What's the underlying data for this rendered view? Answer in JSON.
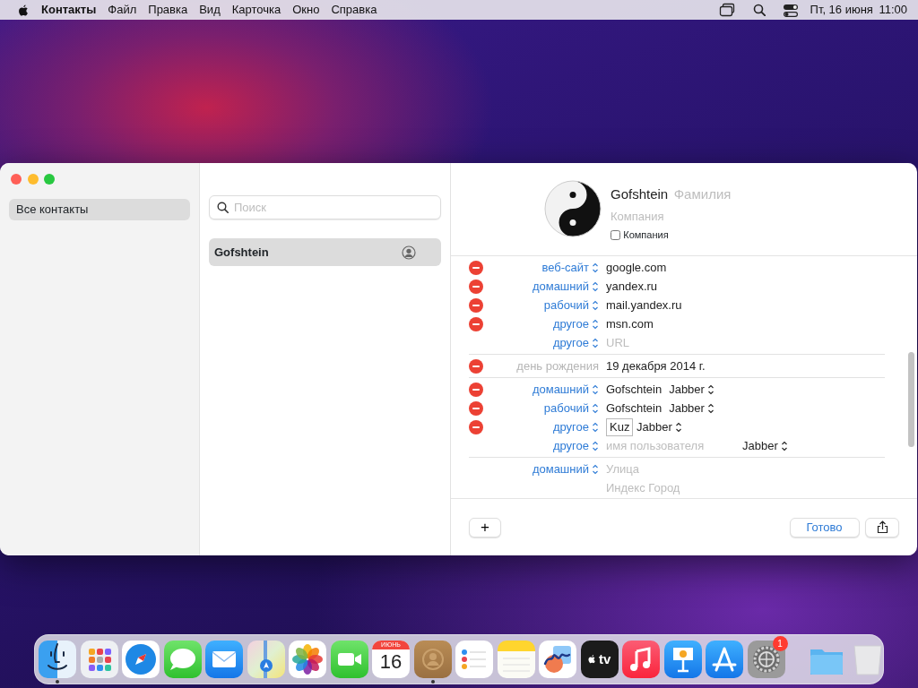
{
  "menubar": {
    "app": "Контакты",
    "menus": [
      "Файл",
      "Правка",
      "Вид",
      "Карточка",
      "Окно",
      "Справка"
    ],
    "date": "Пт, 16 июня",
    "time": "11:00"
  },
  "sidebar": {
    "items": [
      {
        "label": "Все контакты",
        "selected": true
      }
    ]
  },
  "search": {
    "placeholder": "Поиск"
  },
  "contacts": [
    {
      "name": "Gofshtein",
      "selected": true
    }
  ],
  "card": {
    "first_name": "Gofshtein",
    "last_name_placeholder": "Фамилия",
    "company_placeholder": "Компания",
    "company_checkbox": {
      "label": "Компания",
      "checked": false
    },
    "groups": [
      {
        "rows": [
          {
            "label": "веб-сайт",
            "popup": true,
            "removable": true,
            "value": "google.com"
          },
          {
            "label": "домашний",
            "popup": true,
            "removable": true,
            "value": "yandex.ru"
          },
          {
            "label": "рабочий",
            "popup": true,
            "removable": true,
            "value": "mail.yandex.ru"
          },
          {
            "label": "другое",
            "popup": true,
            "removable": true,
            "value": "msn.com"
          },
          {
            "label": "другое",
            "popup": true,
            "removable": false,
            "placeholder": "URL"
          }
        ]
      },
      {
        "rows": [
          {
            "label": "день рождения",
            "popup": false,
            "removable": true,
            "value": "19 декабря 2014 г."
          }
        ]
      },
      {
        "rows": [
          {
            "label": "домашний",
            "popup": true,
            "removable": true,
            "value": "Gofschtein",
            "service": "Jabber"
          },
          {
            "label": "рабочий",
            "popup": true,
            "removable": true,
            "value": "Gofschtein",
            "service": "Jabber"
          },
          {
            "label": "другое",
            "popup": true,
            "removable": true,
            "value": "Kuz",
            "editing": true,
            "service": "Jabber"
          },
          {
            "label": "другое",
            "popup": true,
            "removable": false,
            "placeholder": "имя пользователя",
            "service": "Jabber"
          }
        ]
      },
      {
        "rows": [
          {
            "label": "домашний",
            "popup": true,
            "removable": false,
            "placeholder": "Улица"
          },
          {
            "removable": false,
            "placeholder": "Индекс Город"
          }
        ]
      }
    ]
  },
  "footer": {
    "add": "+",
    "done": "Готово"
  },
  "dock": [
    {
      "kind": "finder",
      "running": true
    },
    {
      "kind": "launchpad",
      "running": false
    },
    {
      "kind": "safari",
      "running": false
    },
    {
      "kind": "messages",
      "running": false
    },
    {
      "kind": "mail",
      "running": false
    },
    {
      "kind": "maps",
      "running": false
    },
    {
      "kind": "photos",
      "running": false
    },
    {
      "kind": "facetime",
      "running": false
    },
    {
      "kind": "calendar",
      "running": false,
      "month": "ИЮНЬ",
      "day": "16"
    },
    {
      "kind": "contacts",
      "running": true
    },
    {
      "kind": "reminders",
      "running": false
    },
    {
      "kind": "notes",
      "running": false
    },
    {
      "kind": "freeform",
      "running": false
    },
    {
      "kind": "tv",
      "running": false,
      "label": "tv"
    },
    {
      "kind": "music",
      "running": false
    },
    {
      "kind": "keynote",
      "running": false
    },
    {
      "kind": "appstore",
      "running": false
    },
    {
      "kind": "settings",
      "running": false,
      "badge": "1"
    },
    {
      "kind": "separator"
    },
    {
      "kind": "folder",
      "running": false
    },
    {
      "kind": "trash",
      "running": false
    }
  ]
}
